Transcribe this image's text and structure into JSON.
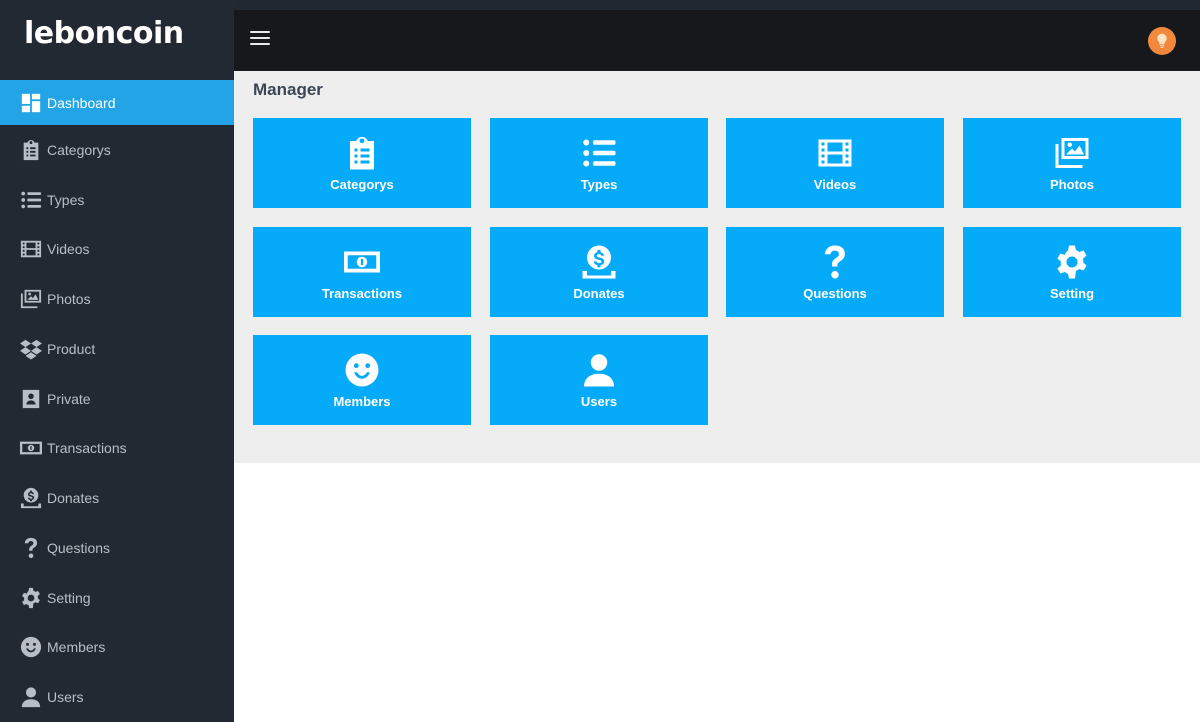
{
  "app": {
    "logo": "leboncoin"
  },
  "colors": {
    "sidebar_bg": "#232932",
    "active_bg": "#23a4e6",
    "tile_bg": "#05aaf9",
    "topbar_bg": "#16181c",
    "avatar": "#f2883b"
  },
  "sidebar": {
    "items": [
      {
        "label": "Dashboard",
        "icon": "dashboard-icon",
        "active": true
      },
      {
        "label": "Categorys",
        "icon": "clipboard-list-icon"
      },
      {
        "label": "Types",
        "icon": "list-icon"
      },
      {
        "label": "Videos",
        "icon": "film-icon"
      },
      {
        "label": "Photos",
        "icon": "images-icon"
      },
      {
        "label": "Product",
        "icon": "dropbox-icon"
      },
      {
        "label": "Private",
        "icon": "contact-card-icon"
      },
      {
        "label": "Transactions",
        "icon": "money-bill-icon"
      },
      {
        "label": "Donates",
        "icon": "donate-icon"
      },
      {
        "label": "Questions",
        "icon": "question-icon"
      },
      {
        "label": "Setting",
        "icon": "gear-icon"
      },
      {
        "label": "Members",
        "icon": "smile-icon"
      },
      {
        "label": "Users",
        "icon": "user-icon"
      }
    ]
  },
  "header": {
    "menu_icon": "hamburger-icon",
    "avatar_icon": "lightbulb-icon"
  },
  "main": {
    "title": "Manager",
    "tiles": [
      {
        "label": "Categorys",
        "icon": "clipboard-list-icon"
      },
      {
        "label": "Types",
        "icon": "list-icon"
      },
      {
        "label": "Videos",
        "icon": "film-icon"
      },
      {
        "label": "Photos",
        "icon": "images-icon"
      },
      {
        "label": "Transactions",
        "icon": "money-bill-icon"
      },
      {
        "label": "Donates",
        "icon": "donate-icon"
      },
      {
        "label": "Questions",
        "icon": "question-icon"
      },
      {
        "label": "Setting",
        "icon": "gear-icon"
      },
      {
        "label": "Members",
        "icon": "smile-icon"
      },
      {
        "label": "Users",
        "icon": "user-icon"
      }
    ]
  }
}
